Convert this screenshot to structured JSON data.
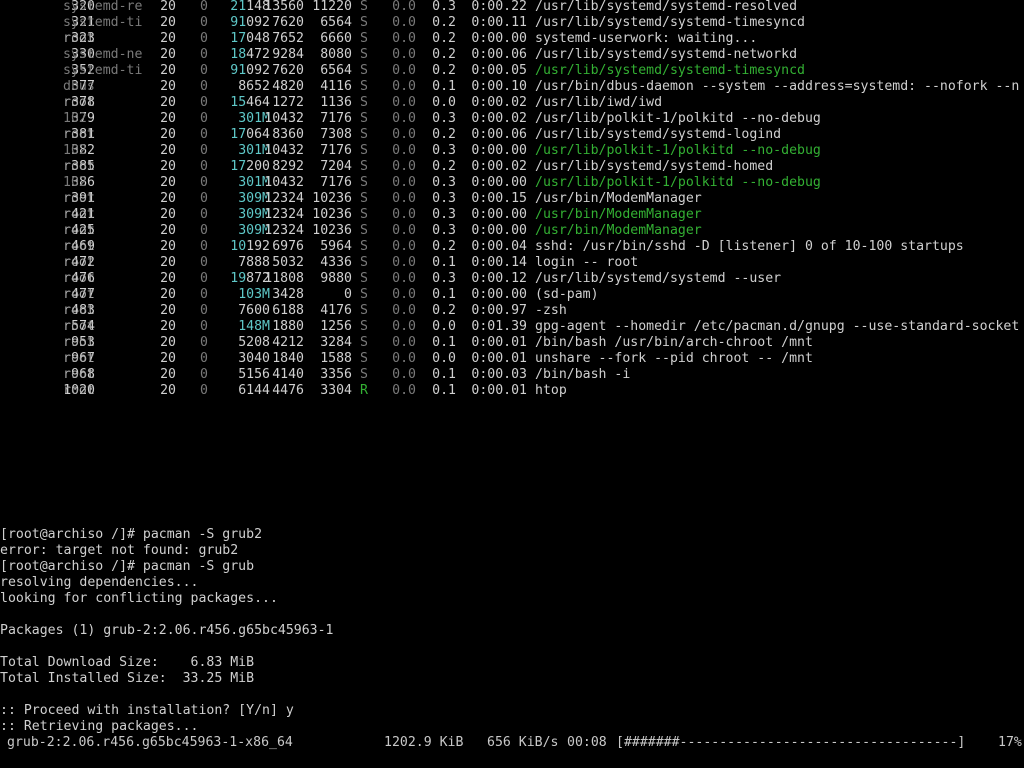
{
  "htop": {
    "rows": [
      {
        "pid": "320",
        "user": "systemd-re",
        "user_style": "dim",
        "pri": "20",
        "ni": "0",
        "virt_hi": "21",
        "virt_lo": "148",
        "res": "13560",
        "shr": "11220",
        "s": "S",
        "s_style": "dim",
        "cpu": "0.0",
        "mem": "0.3",
        "time": "0:00.22",
        "cmd": "/usr/lib/systemd/systemd-resolved",
        "cmd_style": "white"
      },
      {
        "pid": "321",
        "user": "systemd-ti",
        "user_style": "dim",
        "pri": "20",
        "ni": "0",
        "virt_hi": "91",
        "virt_lo": "092",
        "res": "7620",
        "shr": "6564",
        "s": "S",
        "s_style": "dim",
        "cpu": "0.0",
        "mem": "0.2",
        "time": "0:00.11",
        "cmd": "/usr/lib/systemd/systemd-timesyncd",
        "cmd_style": "white"
      },
      {
        "pid": "323",
        "user": "root",
        "user_style": "gray",
        "pri": "20",
        "ni": "0",
        "virt_hi": "17",
        "virt_lo": "048",
        "res": "7652",
        "shr": "6660",
        "s": "S",
        "s_style": "dim",
        "cpu": "0.0",
        "mem": "0.2",
        "time": "0:00.00",
        "cmd": "systemd-userwork: waiting...",
        "cmd_style": "white"
      },
      {
        "pid": "330",
        "user": "systemd-ne",
        "user_style": "dim",
        "pri": "20",
        "ni": "0",
        "virt_hi": "18",
        "virt_lo": "472",
        "res": "9284",
        "shr": "8080",
        "s": "S",
        "s_style": "dim",
        "cpu": "0.0",
        "mem": "0.2",
        "time": "0:00.06",
        "cmd": "/usr/lib/systemd/systemd-networkd",
        "cmd_style": "white"
      },
      {
        "pid": "352",
        "user": "systemd-ti",
        "user_style": "dim",
        "pri": "20",
        "ni": "0",
        "virt_hi": "91",
        "virt_lo": "092",
        "res": "7620",
        "shr": "6564",
        "s": "S",
        "s_style": "dim",
        "cpu": "0.0",
        "mem": "0.2",
        "time": "0:00.05",
        "cmd": "/usr/lib/systemd/systemd-timesyncd",
        "cmd_style": "green"
      },
      {
        "pid": "377",
        "user": "dbus",
        "user_style": "dim",
        "pri": "20",
        "ni": "0",
        "virt_hi": "",
        "virt_lo": "8652",
        "res": "4820",
        "shr": "4116",
        "s": "S",
        "s_style": "dim",
        "cpu": "0.0",
        "mem": "0.1",
        "time": "0:00.10",
        "cmd": "/usr/bin/dbus-daemon --system --address=systemd: --nofork --n",
        "cmd_style": "white"
      },
      {
        "pid": "378",
        "user": "root",
        "user_style": "gray",
        "pri": "20",
        "ni": "0",
        "virt_hi": "15",
        "virt_lo": "464",
        "res": "1272",
        "shr": "1136",
        "s": "S",
        "s_style": "dim",
        "cpu": "0.0",
        "mem": "0.0",
        "time": "0:00.02",
        "cmd": "/usr/lib/iwd/iwd",
        "cmd_style": "white"
      },
      {
        "pid": "379",
        "user": "102",
        "user_style": "dim",
        "pri": "20",
        "ni": "0",
        "virt_hi": "301M",
        "virt_lo": "",
        "res": "10432",
        "shr": "7176",
        "s": "S",
        "s_style": "dim",
        "cpu": "0.0",
        "mem": "0.3",
        "time": "0:00.02",
        "cmd": "/usr/lib/polkit-1/polkitd --no-debug",
        "cmd_style": "white"
      },
      {
        "pid": "381",
        "user": "root",
        "user_style": "gray",
        "pri": "20",
        "ni": "0",
        "virt_hi": "17",
        "virt_lo": "064",
        "res": "8360",
        "shr": "7308",
        "s": "S",
        "s_style": "dim",
        "cpu": "0.0",
        "mem": "0.2",
        "time": "0:00.06",
        "cmd": "/usr/lib/systemd/systemd-logind",
        "cmd_style": "white"
      },
      {
        "pid": "382",
        "user": "102",
        "user_style": "dim",
        "pri": "20",
        "ni": "0",
        "virt_hi": "301M",
        "virt_lo": "",
        "res": "10432",
        "shr": "7176",
        "s": "S",
        "s_style": "dim",
        "cpu": "0.0",
        "mem": "0.3",
        "time": "0:00.00",
        "cmd": "/usr/lib/polkit-1/polkitd --no-debug",
        "cmd_style": "green"
      },
      {
        "pid": "385",
        "user": "root",
        "user_style": "gray",
        "pri": "20",
        "ni": "0",
        "virt_hi": "17",
        "virt_lo": "200",
        "res": "8292",
        "shr": "7204",
        "s": "S",
        "s_style": "dim",
        "cpu": "0.0",
        "mem": "0.2",
        "time": "0:00.02",
        "cmd": "/usr/lib/systemd/systemd-homed",
        "cmd_style": "white"
      },
      {
        "pid": "386",
        "user": "102",
        "user_style": "dim",
        "pri": "20",
        "ni": "0",
        "virt_hi": "301M",
        "virt_lo": "",
        "res": "10432",
        "shr": "7176",
        "s": "S",
        "s_style": "dim",
        "cpu": "0.0",
        "mem": "0.3",
        "time": "0:00.00",
        "cmd": "/usr/lib/polkit-1/polkitd --no-debug",
        "cmd_style": "green"
      },
      {
        "pid": "391",
        "user": "root",
        "user_style": "gray",
        "pri": "20",
        "ni": "0",
        "virt_hi": "309M",
        "virt_lo": "",
        "res": "12324",
        "shr": "10236",
        "s": "S",
        "s_style": "dim",
        "cpu": "0.0",
        "mem": "0.3",
        "time": "0:00.15",
        "cmd": "/usr/bin/ModemManager",
        "cmd_style": "white"
      },
      {
        "pid": "421",
        "user": "root",
        "user_style": "gray",
        "pri": "20",
        "ni": "0",
        "virt_hi": "309M",
        "virt_lo": "",
        "res": "12324",
        "shr": "10236",
        "s": "S",
        "s_style": "dim",
        "cpu": "0.0",
        "mem": "0.3",
        "time": "0:00.00",
        "cmd": "/usr/bin/ModemManager",
        "cmd_style": "green"
      },
      {
        "pid": "425",
        "user": "root",
        "user_style": "gray",
        "pri": "20",
        "ni": "0",
        "virt_hi": "309M",
        "virt_lo": "",
        "res": "12324",
        "shr": "10236",
        "s": "S",
        "s_style": "dim",
        "cpu": "0.0",
        "mem": "0.3",
        "time": "0:00.00",
        "cmd": "/usr/bin/ModemManager",
        "cmd_style": "green"
      },
      {
        "pid": "469",
        "user": "root",
        "user_style": "gray",
        "pri": "20",
        "ni": "0",
        "virt_hi": "10",
        "virt_lo": "192",
        "res": "6976",
        "shr": "5964",
        "s": "S",
        "s_style": "dim",
        "cpu": "0.0",
        "mem": "0.2",
        "time": "0:00.04",
        "cmd": "sshd: /usr/bin/sshd -D [listener] 0 of 10-100 startups",
        "cmd_style": "white"
      },
      {
        "pid": "472",
        "user": "root",
        "user_style": "gray",
        "pri": "20",
        "ni": "0",
        "virt_hi": "",
        "virt_lo": "7888",
        "res": "5032",
        "shr": "4336",
        "s": "S",
        "s_style": "dim",
        "cpu": "0.0",
        "mem": "0.1",
        "time": "0:00.14",
        "cmd": "login -- root",
        "cmd_style": "white"
      },
      {
        "pid": "476",
        "user": "root",
        "user_style": "gray",
        "pri": "20",
        "ni": "0",
        "virt_hi": "19",
        "virt_lo": "872",
        "res": "11808",
        "shr": "9880",
        "s": "S",
        "s_style": "dim",
        "cpu": "0.0",
        "mem": "0.3",
        "time": "0:00.12",
        "cmd": "/usr/lib/systemd/systemd --user",
        "cmd_style": "white"
      },
      {
        "pid": "477",
        "user": "root",
        "user_style": "gray",
        "pri": "20",
        "ni": "0",
        "virt_hi": "103M",
        "virt_lo": "",
        "res": "3428",
        "shr": "0",
        "s": "S",
        "s_style": "dim",
        "cpu": "0.0",
        "mem": "0.1",
        "time": "0:00.00",
        "cmd": "(sd-pam)",
        "cmd_style": "white"
      },
      {
        "pid": "483",
        "user": "root",
        "user_style": "gray",
        "pri": "20",
        "ni": "0",
        "virt_hi": "",
        "virt_lo": "7600",
        "res": "6188",
        "shr": "4176",
        "s": "S",
        "s_style": "dim",
        "cpu": "0.0",
        "mem": "0.2",
        "time": "0:00.97",
        "cmd": "-zsh",
        "cmd_style": "white"
      },
      {
        "pid": "574",
        "user": "root",
        "user_style": "gray",
        "pri": "20",
        "ni": "0",
        "virt_hi": "148M",
        "virt_lo": "",
        "res": "1880",
        "shr": "1256",
        "s": "S",
        "s_style": "dim",
        "cpu": "0.0",
        "mem": "0.0",
        "time": "0:01.39",
        "cmd": "gpg-agent --homedir /etc/pacman.d/gnupg --use-standard-socket",
        "cmd_style": "white"
      },
      {
        "pid": "953",
        "user": "root",
        "user_style": "gray",
        "pri": "20",
        "ni": "0",
        "virt_hi": "",
        "virt_lo": "5208",
        "res": "4212",
        "shr": "3284",
        "s": "S",
        "s_style": "dim",
        "cpu": "0.0",
        "mem": "0.1",
        "time": "0:00.01",
        "cmd": "/bin/bash /usr/bin/arch-chroot /mnt",
        "cmd_style": "white"
      },
      {
        "pid": "967",
        "user": "root",
        "user_style": "gray",
        "pri": "20",
        "ni": "0",
        "virt_hi": "",
        "virt_lo": "3040",
        "res": "1840",
        "shr": "1588",
        "s": "S",
        "s_style": "dim",
        "cpu": "0.0",
        "mem": "0.0",
        "time": "0:00.01",
        "cmd": "unshare --fork --pid chroot -- /mnt",
        "cmd_style": "white"
      },
      {
        "pid": "968",
        "user": "root",
        "user_style": "gray",
        "pri": "20",
        "ni": "0",
        "virt_hi": "",
        "virt_lo": "5156",
        "res": "4140",
        "shr": "3356",
        "s": "S",
        "s_style": "dim",
        "cpu": "0.0",
        "mem": "0.1",
        "time": "0:00.03",
        "cmd": "/bin/bash -i",
        "cmd_style": "white"
      },
      {
        "pid": "1020",
        "user": "root",
        "user_style": "gray",
        "pri": "20",
        "ni": "0",
        "virt_hi": "",
        "virt_lo": "6144",
        "res": "4476",
        "shr": "3304",
        "s": "R",
        "s_style": "green",
        "cpu": "0.0",
        "mem": "0.1",
        "time": "0:00.01",
        "cmd": "htop",
        "cmd_style": "white"
      }
    ]
  },
  "shell": {
    "lines": [
      "[root@archiso /]# pacman -S grub2",
      "error: target not found: grub2",
      "[root@archiso /]# pacman -S grub",
      "resolving dependencies...",
      "looking for conflicting packages...",
      "",
      "Packages (1) grub-2:2.06.r456.g65bc45963-1",
      "",
      "Total Download Size:    6.83 MiB",
      "Total Installed Size:  33.25 MiB",
      "",
      ":: Proceed with installation? [Y/n] y",
      ":: Retrieving packages..."
    ]
  },
  "download": {
    "package": "grub-2:2.06.r456.g65bc45963-1-x86_64",
    "size": "1202.9 KiB",
    "rate": "656 KiB/s",
    "eta": "00:08",
    "bar": "[#######-----------------------------------]",
    "percent": "17%",
    "progress": 0.17
  }
}
